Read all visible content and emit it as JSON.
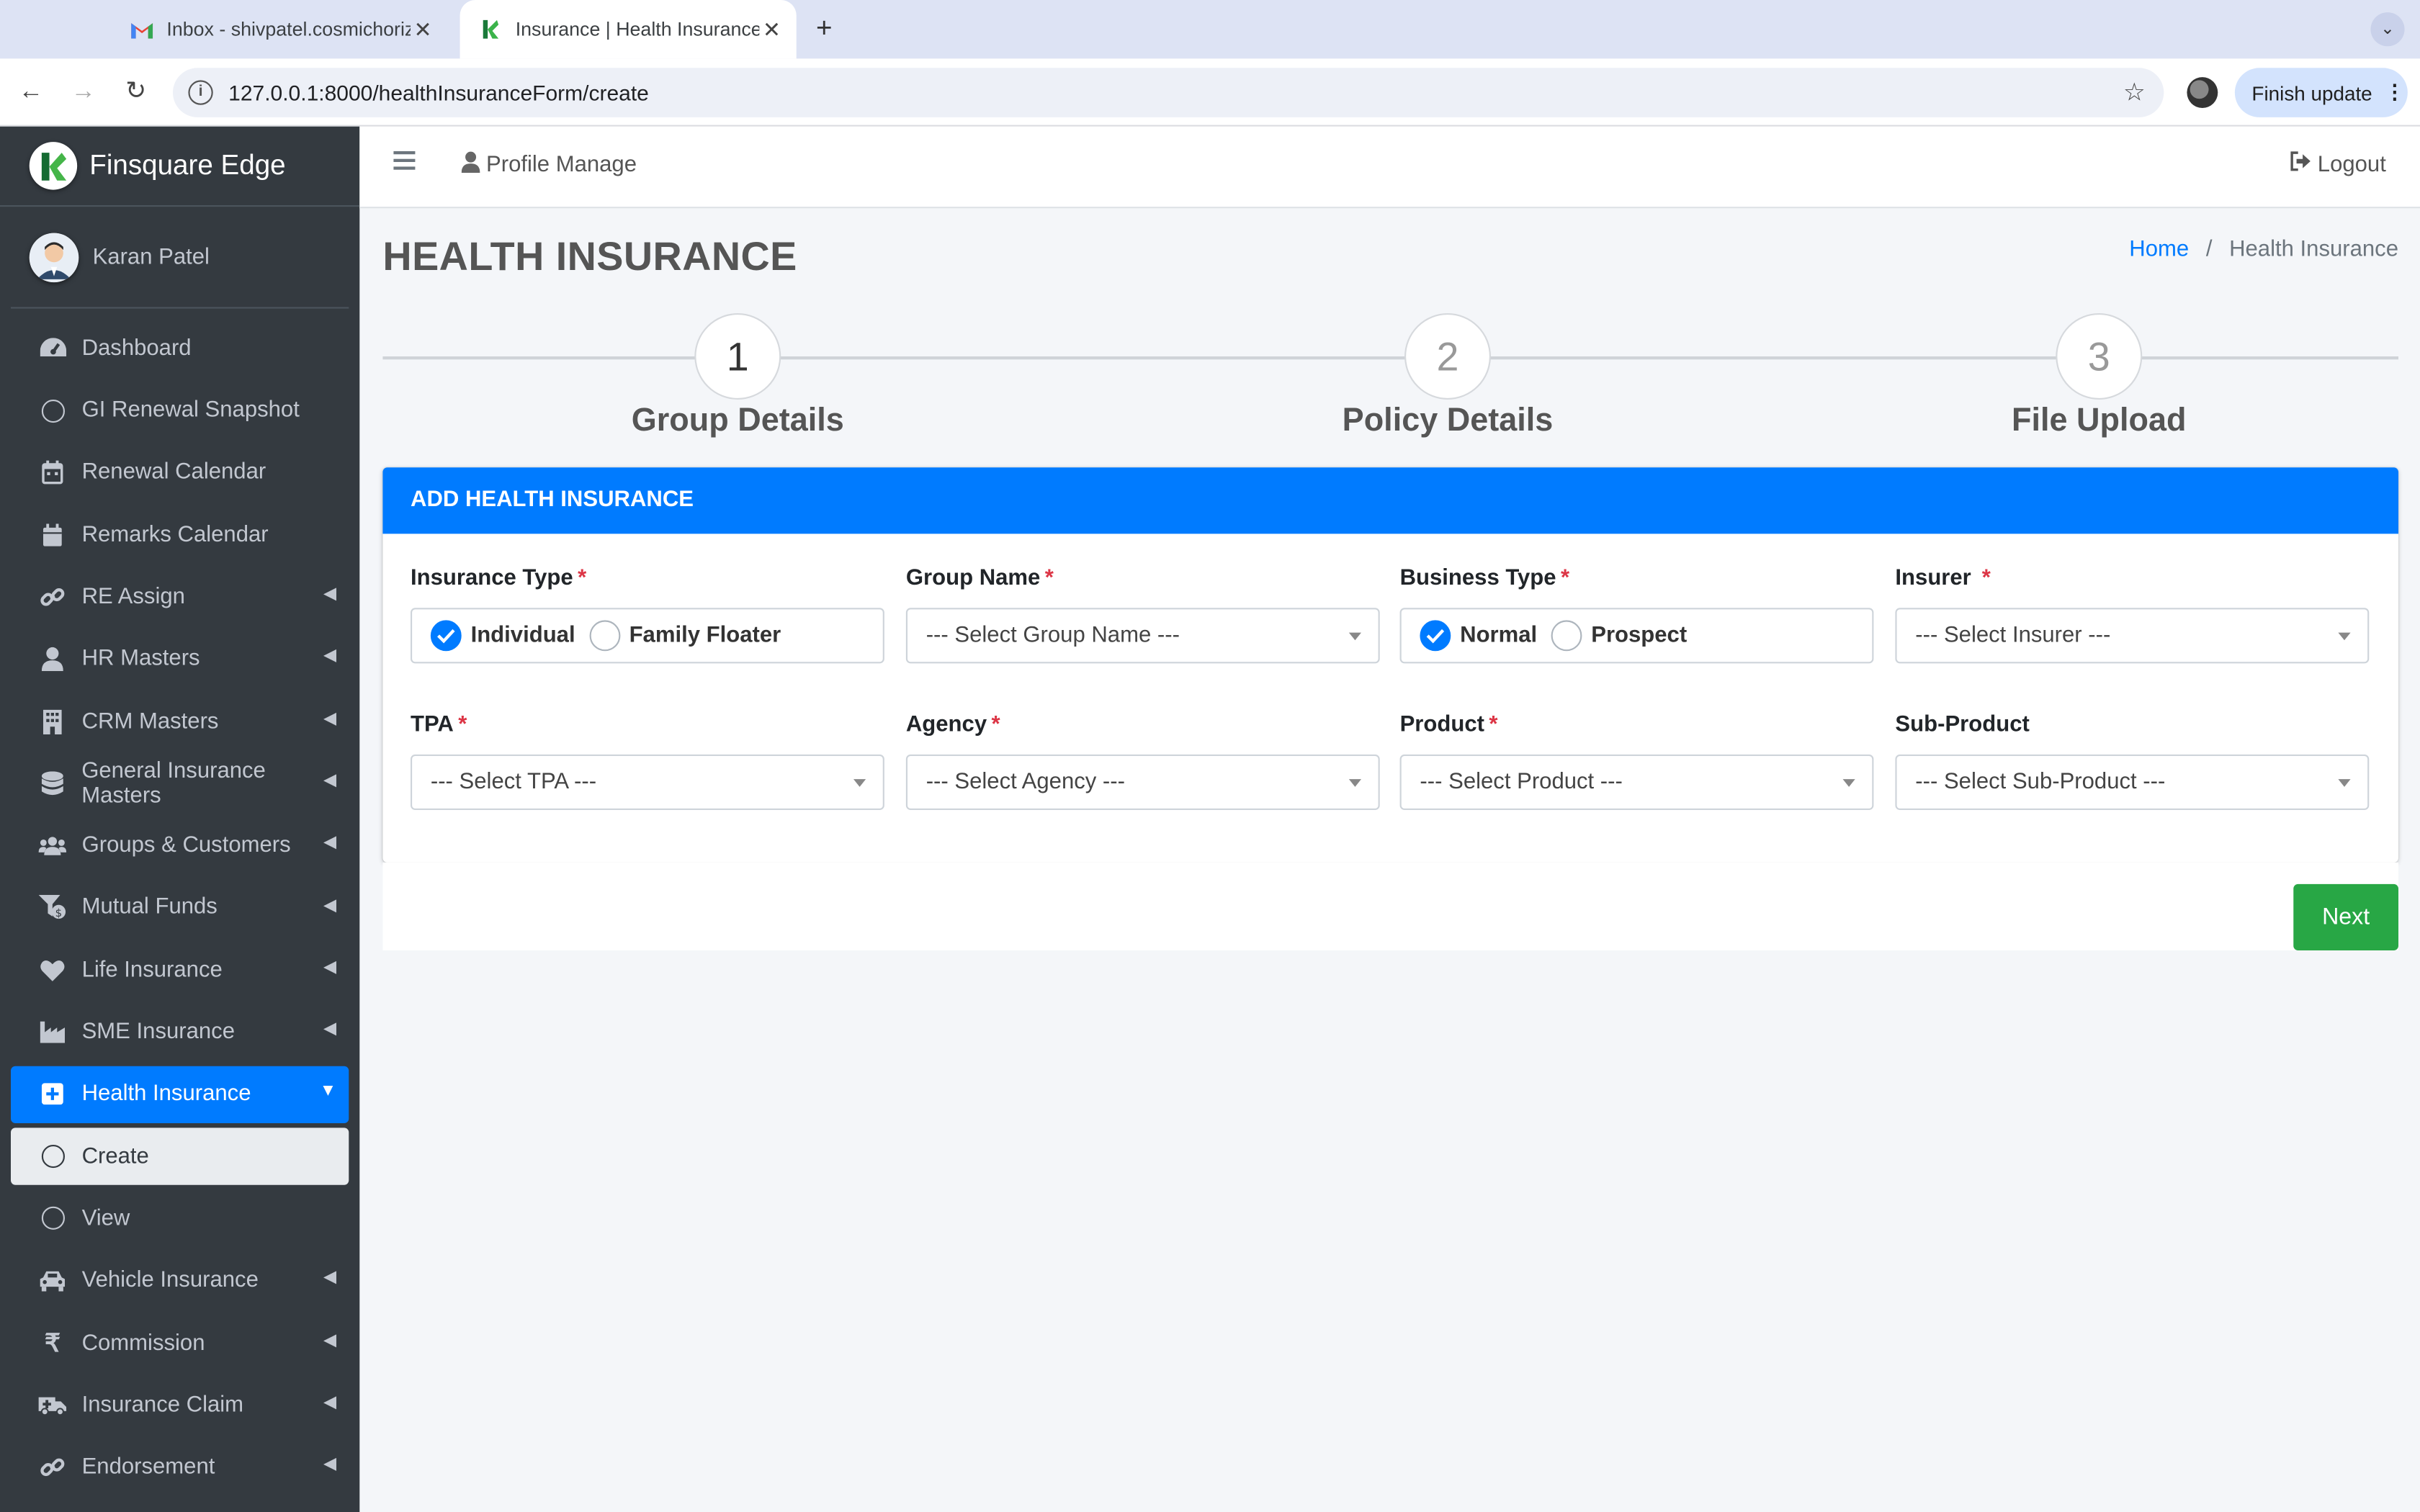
{
  "browser": {
    "tabs": [
      {
        "title": "Inbox - shivpatel.cosmichorizon",
        "active": false
      },
      {
        "title": "Insurance | Health Insurance",
        "active": true
      }
    ],
    "url": "127.0.0.1:8000/healthInsuranceForm/create",
    "finish_update": "Finish update"
  },
  "sidebar": {
    "brand": "Finsquare Edge",
    "user": "Karan Patel",
    "items": [
      {
        "label": "Dashboard",
        "icon": "dashboard-icon"
      },
      {
        "label": "GI Renewal Snapshot",
        "icon": "circle-icon"
      },
      {
        "label": "Renewal Calendar",
        "icon": "calendar-icon"
      },
      {
        "label": "Remarks Calendar",
        "icon": "calendar-icon"
      },
      {
        "label": "RE Assign",
        "icon": "link-icon"
      },
      {
        "label": "HR Masters",
        "icon": "user-icon"
      },
      {
        "label": "CRM Masters",
        "icon": "building-icon"
      },
      {
        "label": "General Insurance Masters",
        "icon": "database-icon"
      },
      {
        "label": "Groups & Customers",
        "icon": "users-icon"
      },
      {
        "label": "Mutual Funds",
        "icon": "funnel-dollar-icon"
      },
      {
        "label": "Life Insurance",
        "icon": "heart-icon"
      },
      {
        "label": "SME Insurance",
        "icon": "industry-icon"
      },
      {
        "label": "Health Insurance",
        "icon": "plus-square-icon"
      },
      {
        "label": "Create",
        "icon": "circle-icon"
      },
      {
        "label": "View",
        "icon": "circle-icon"
      },
      {
        "label": "Vehicle Insurance",
        "icon": "car-icon"
      },
      {
        "label": "Commission",
        "icon": "rupee-icon"
      },
      {
        "label": "Insurance Claim",
        "icon": "ambulance-icon"
      },
      {
        "label": "Endorsement",
        "icon": "link-icon"
      }
    ]
  },
  "topnav": {
    "profile": "Profile Manage",
    "logout": "Logout"
  },
  "page": {
    "title": "HEALTH INSURANCE",
    "breadcrumb": {
      "home": "Home",
      "sep": "/",
      "current": "Health Insurance"
    }
  },
  "steps": [
    {
      "num": "1",
      "label": "Group Details"
    },
    {
      "num": "2",
      "label": "Policy Details"
    },
    {
      "num": "3",
      "label": "File Upload"
    }
  ],
  "form": {
    "header": "ADD HEALTH INSURANCE",
    "required_mark": "*",
    "insurance_type": {
      "label": "Insurance Type",
      "options": [
        "Individual",
        "Family Floater"
      ],
      "selected": "Individual"
    },
    "group_name": {
      "label": "Group Name",
      "value": "--- Select Group Name ---"
    },
    "business_type": {
      "label": "Business Type",
      "options": [
        "Normal",
        "Prospect"
      ],
      "selected": "Normal"
    },
    "insurer": {
      "label": "Insurer",
      "value": "--- Select Insurer ---"
    },
    "tpa": {
      "label": "TPA",
      "value": "--- Select TPA ---"
    },
    "agency": {
      "label": "Agency",
      "value": "--- Select Agency ---"
    },
    "product": {
      "label": "Product",
      "value": "--- Select Product ---"
    },
    "sub_product": {
      "label": "Sub-Product",
      "value": "--- Select Sub-Product ---"
    },
    "next": "Next"
  },
  "colors": {
    "primary": "#007bff",
    "success": "#28a745",
    "sidebar": "#343a40",
    "danger": "#dc3545"
  }
}
